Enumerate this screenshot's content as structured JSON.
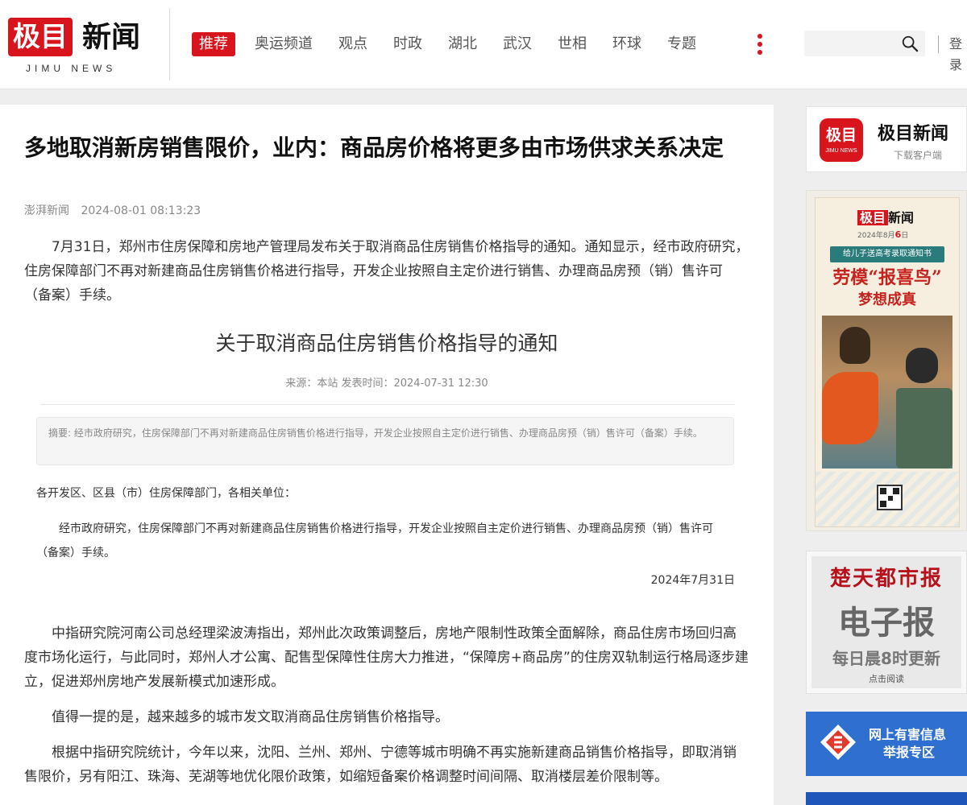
{
  "header": {
    "logo_mark": "极目",
    "logo_word": "新闻",
    "logo_sub": "JIMU NEWS",
    "nav": [
      "推荐",
      "奥运频道",
      "观点",
      "时政",
      "湖北",
      "武汉",
      "世相",
      "环球",
      "专题"
    ],
    "search_placeholder": "",
    "login": "登录"
  },
  "article": {
    "title": "多地取消新房销售限价，业内：商品房价格将更多由市场供求关系决定",
    "source": "澎湃新闻",
    "date": "2024-08-01 08:13:23",
    "p1": "7月31日，郑州市住房保障和房地产管理局发布关于取消商品住房销售价格指导的通知。通知显示，经市政府研究，住房保障部门不再对新建商品住房销售价格进行指导，开发企业按照自主定价进行销售、办理商品房预（销）售许可（备案）手续。",
    "notice": {
      "title": "关于取消商品住房销售价格指导的通知",
      "source_line": "来源：本站  发表时间：2024-07-31 12:30",
      "abstract": "摘要: 经市政府研究，住房保障部门不再对新建商品住房销售价格进行指导，开发企业按照自主定价进行销售、办理商品房预（销）售许可（备案）手续。",
      "addressee": "各开发区、区县（市）住房保障部门，各相关单位：",
      "body": "经市政府研究，住房保障部门不再对新建商品住房销售价格进行指导，开发企业按照自主定价进行销售、办理商品房预（销）售许可（备案）手续。",
      "date": "2024年7月31日"
    },
    "p2": "中指研究院河南公司总经理梁波涛指出，郑州此次政策调整后，房地产限制性政策全面解除，商品住房市场回归高度市场化运行，与此同时，郑州人才公寓、配售型保障性住房大力推进，“保障房+商品房”的住房双轨制运行格局逐步建立，促进郑州房地产发展新模式加速形成。",
    "p3": "值得一提的是，越来越多的城市发文取消商品住房销售价格指导。",
    "p4": "根据中指研究院统计，今年以来，沈阳、兰州、郑州、宁德等城市明确不再实施新建商品销售价格指导，即取消销售限价，另有阳江、珠海、芜湖等地优化限价政策，如缩短备案价格调整时间间隔、取消楼层差价限制等。"
  },
  "sidebar": {
    "app": {
      "icon_top": "极目",
      "icon_bottom": "JIMU NEWS",
      "name": "极目新闻",
      "sub": "下载客户端"
    },
    "poster": {
      "logo_mark": "极目",
      "logo_word": "新闻",
      "date_prefix": "2024年8月",
      "date_day": "6",
      "date_suffix": "日",
      "ribbon": "给儿子送高考录取通知书",
      "headline1": "劳模“报喜鸟”",
      "headline2": "梦想成真"
    },
    "paper": {
      "brand": "楚天都市报",
      "big": "电子报",
      "sub": "每日晨8时更新",
      "read": "点击阅读"
    },
    "report": {
      "line1": "网上有害信息",
      "line2": "举报专区"
    }
  },
  "colors": {
    "brand_red": "#d8141d",
    "report_blue": "#2f6fd0"
  }
}
